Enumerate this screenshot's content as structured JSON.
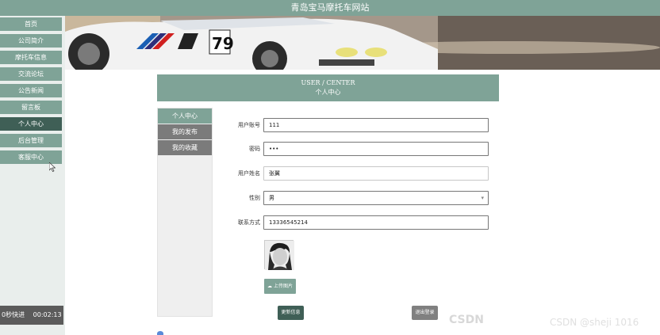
{
  "site_title": "青岛宝马摩托车网站",
  "nav": [
    {
      "label": "首页"
    },
    {
      "label": "公司简介"
    },
    {
      "label": "摩托车信息"
    },
    {
      "label": "交流论坛"
    },
    {
      "label": "公告新闻"
    },
    {
      "label": "留言板"
    },
    {
      "label": "个人中心"
    },
    {
      "label": "后台管理"
    },
    {
      "label": "客服中心"
    }
  ],
  "video_bar": {
    "label": "0秒快进",
    "time": "00:02:13"
  },
  "center": {
    "en": "USER / CENTER",
    "zh": "个人中心"
  },
  "menu": [
    {
      "label": "个人中心"
    },
    {
      "label": "我的发布"
    },
    {
      "label": "我的收藏"
    }
  ],
  "form": {
    "account_label": "用户账号",
    "account_value": "111",
    "password_label": "密码",
    "password_value": "•••",
    "name_label": "用户姓名",
    "name_value": "张翼",
    "gender_label": "性别",
    "gender_value": "男",
    "phone_label": "联系方式",
    "phone_value": "13336545214"
  },
  "upload_label": "上传图片",
  "update_label": "更新信息",
  "logout_label": "退出登录",
  "watermarks": {
    "a": "CSDN",
    "b": "CSDN @sheji 1016"
  },
  "colors": {
    "accent": "#7fa397",
    "active": "#3f5f56",
    "muted": "#808080"
  }
}
